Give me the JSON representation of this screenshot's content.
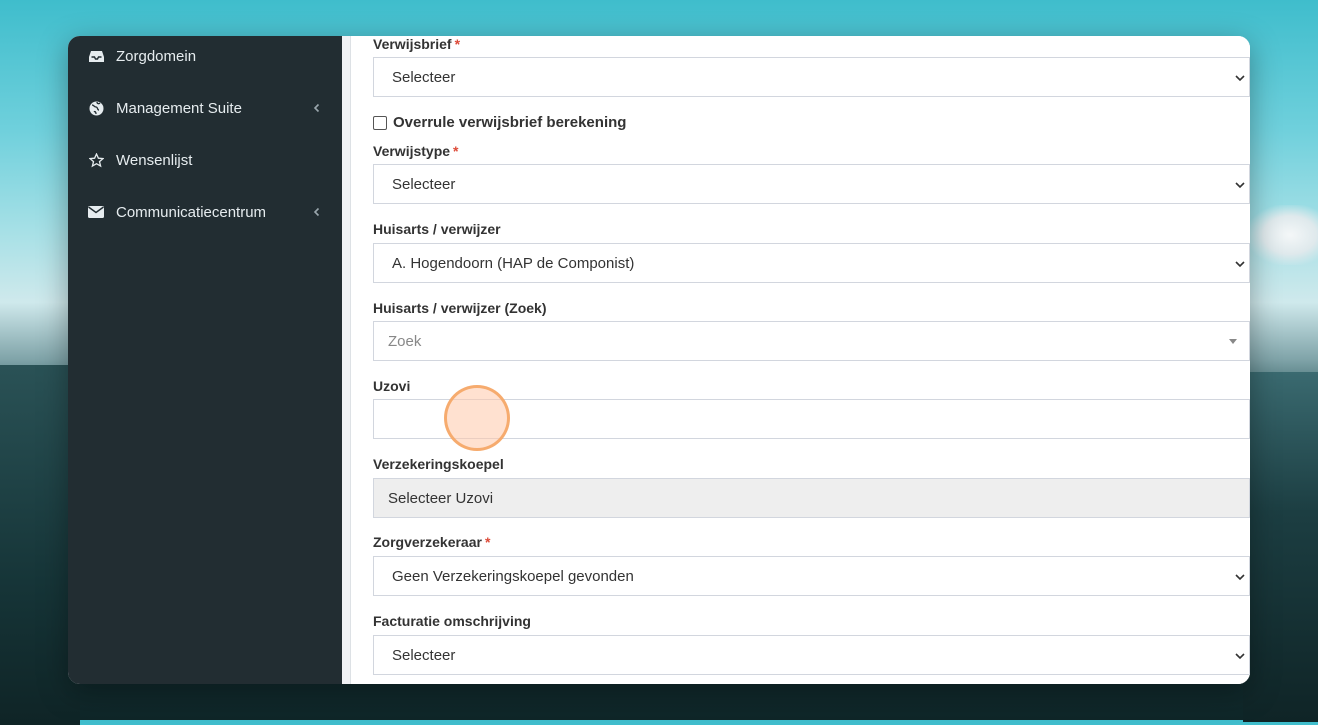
{
  "sidebar": {
    "items": [
      {
        "label": "Zorgdomein",
        "icon": "inbox-icon",
        "has_submenu": false
      },
      {
        "label": "Management Suite",
        "icon": "globe-icon",
        "has_submenu": true
      },
      {
        "label": "Wensenlijst",
        "icon": "star-icon",
        "has_submenu": false
      },
      {
        "label": "Communicatiecentrum",
        "icon": "envelope-icon",
        "has_submenu": true
      }
    ]
  },
  "form": {
    "verwijsbrief": {
      "label": "Verwijsbrief",
      "required": "*",
      "value": "Selecteer"
    },
    "overrule": {
      "label": "Overrule verwijsbrief berekening",
      "checked": false
    },
    "verwijstype": {
      "label": "Verwijstype",
      "required": "*",
      "value": "Selecteer"
    },
    "huisarts": {
      "label": "Huisarts / verwijzer",
      "value": "A. Hogendoorn (HAP de Componist)"
    },
    "huisarts_zoek": {
      "label": "Huisarts / verwijzer (Zoek)",
      "placeholder": "Zoek"
    },
    "uzovi": {
      "label": "Uzovi",
      "value": ""
    },
    "verzekeringskoepel": {
      "label": "Verzekeringskoepel",
      "value": "Selecteer Uzovi"
    },
    "zorgverzekeraar": {
      "label": "Zorgverzekeraar",
      "required": "*",
      "value": "Geen Verzekeringskoepel gevonden"
    },
    "facturatie": {
      "label": "Facturatie omschrijving",
      "value": "Selecteer"
    }
  },
  "colors": {
    "sidebar_bg": "#222d32",
    "required": "#dd4b39"
  }
}
